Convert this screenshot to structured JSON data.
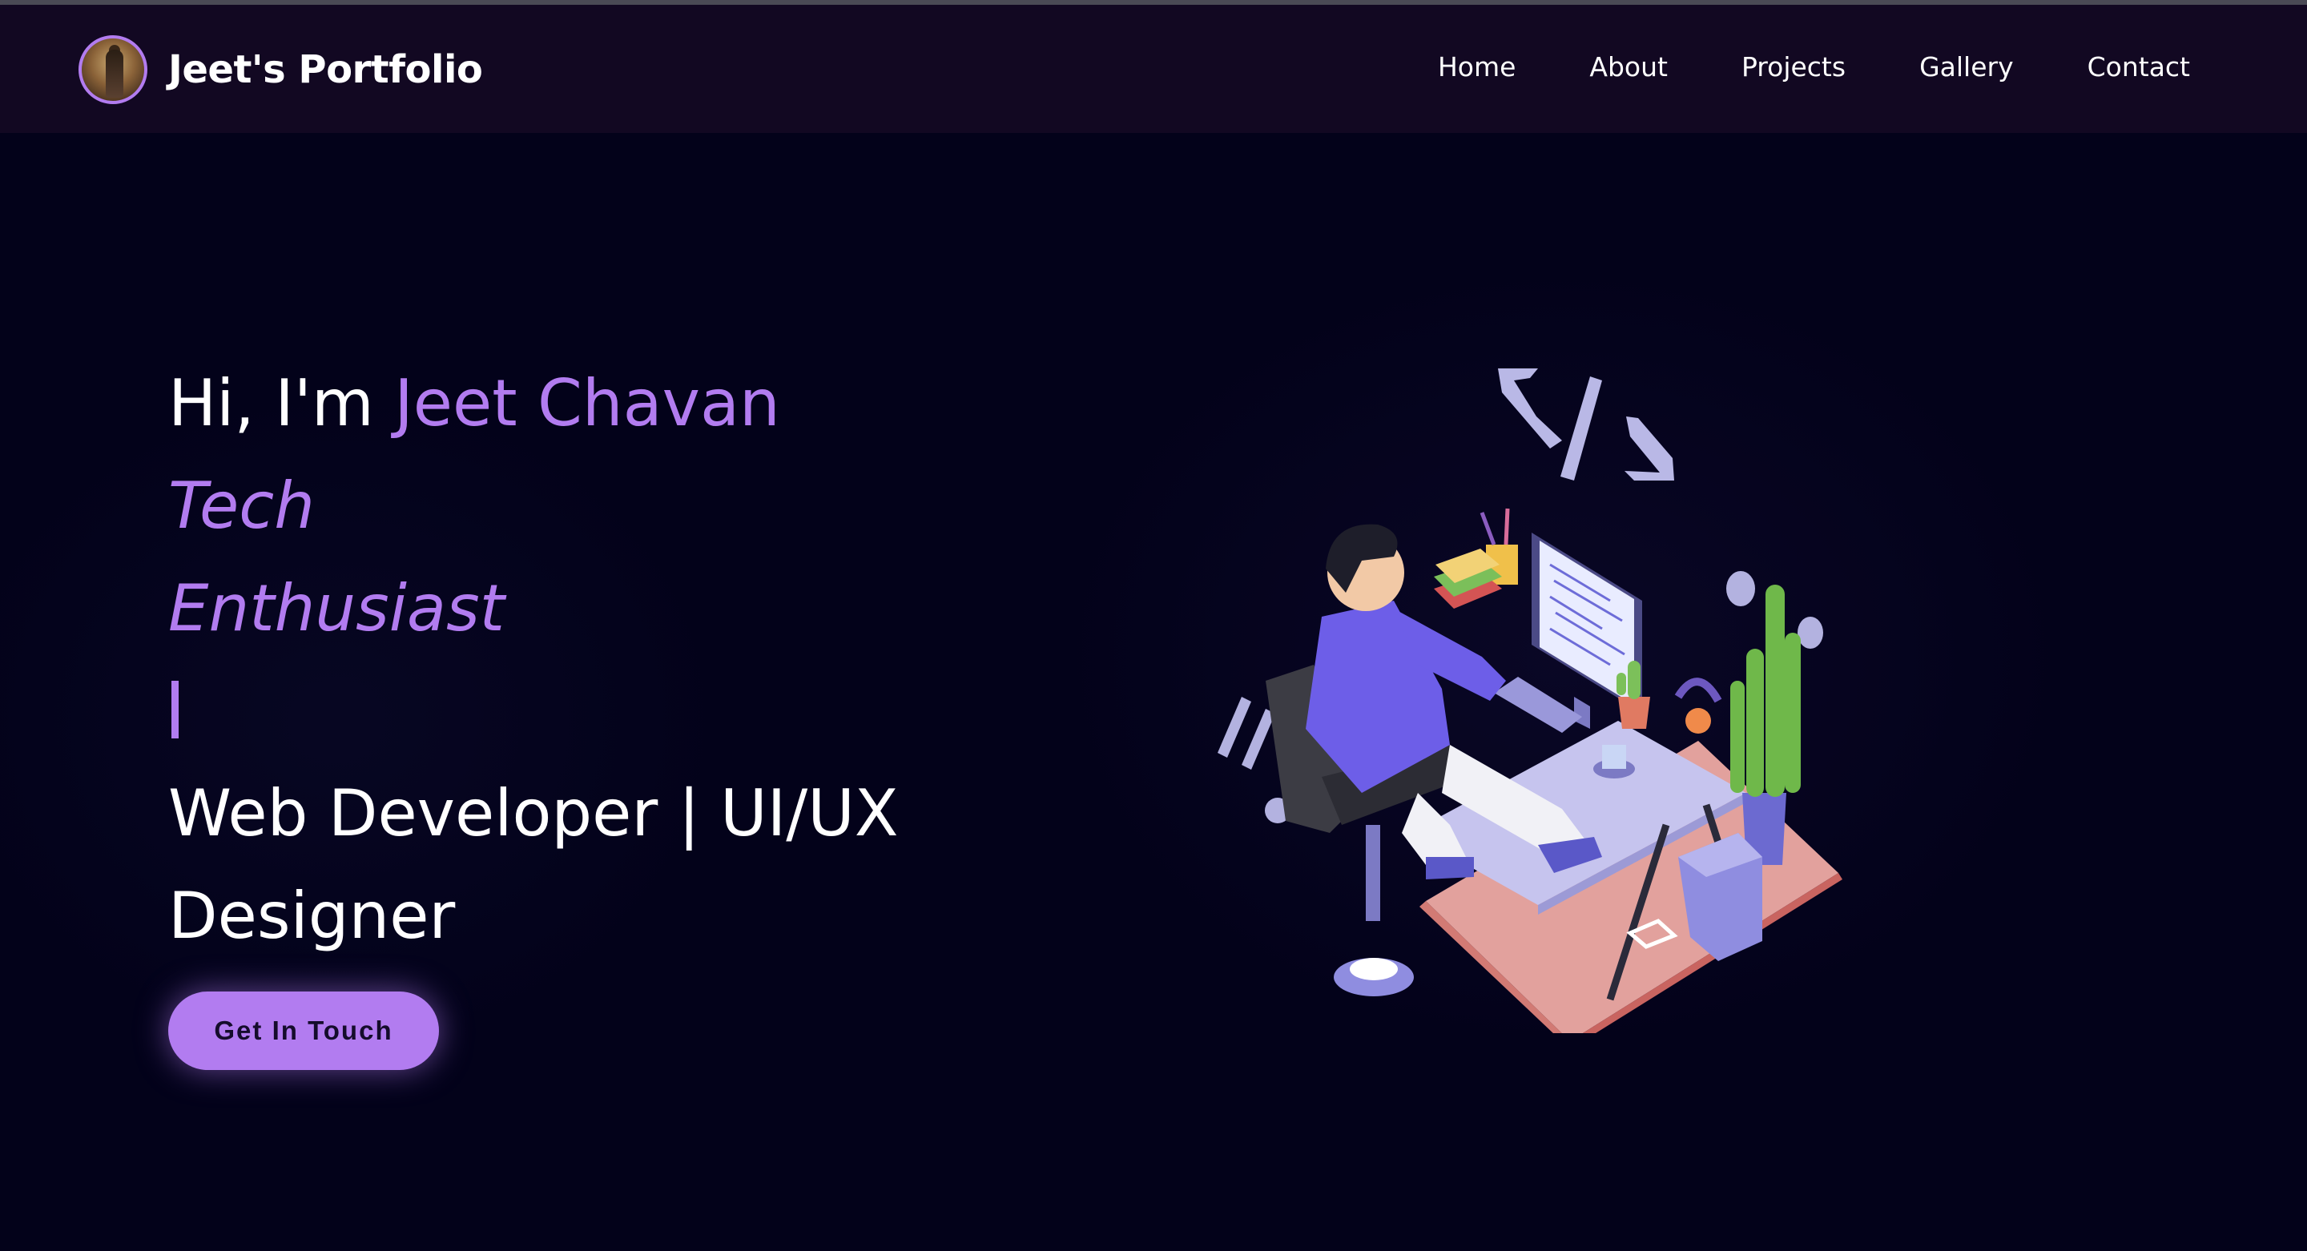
{
  "navbar": {
    "brand_name": "Jeet's Portfolio",
    "links": [
      "Home",
      "About",
      "Projects",
      "Gallery",
      "Contact"
    ]
  },
  "hero": {
    "greeting": "Hi, I'm ",
    "name": "Jeet Chavan",
    "typed_line_1": "Tech",
    "typed_line_2": "Enthusiast",
    "tagline_line_1": "Web Developer | UI/UX",
    "tagline_line_2": "Designer",
    "cta_label": "Get In Touch"
  },
  "colors": {
    "accent": "#b27cf0",
    "background": "#03021a",
    "navbar": "#120822",
    "text": "#ffffff"
  },
  "icons": {
    "avatar": "profile-photo",
    "illustration": "developer-at-desk-illustration"
  }
}
